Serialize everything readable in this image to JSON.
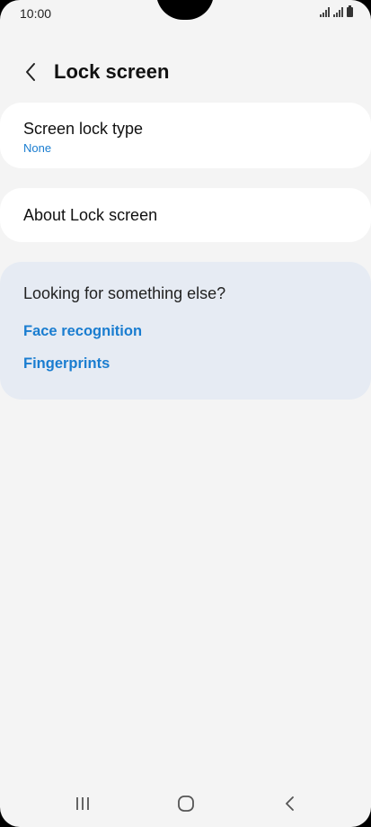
{
  "status_bar": {
    "time": "10:00",
    "icons": [
      "signal-icon",
      "signal-icon",
      "battery-icon"
    ]
  },
  "header": {
    "back_icon": "chevron-left-icon",
    "title": "Lock screen"
  },
  "settings": {
    "screen_lock_type": {
      "label": "Screen lock type",
      "value": "None"
    },
    "about": {
      "label": "About Lock screen"
    }
  },
  "suggestions": {
    "heading": "Looking for something else?",
    "links": [
      {
        "label": "Face recognition"
      },
      {
        "label": "Fingerprints"
      }
    ]
  },
  "nav_bar": {
    "icons": [
      "recents-icon",
      "home-icon",
      "back-icon"
    ]
  },
  "colors": {
    "background": "#f4f4f4",
    "card": "#ffffff",
    "suggestion_card": "#e6ebf3",
    "accent": "#1a7dd0"
  }
}
